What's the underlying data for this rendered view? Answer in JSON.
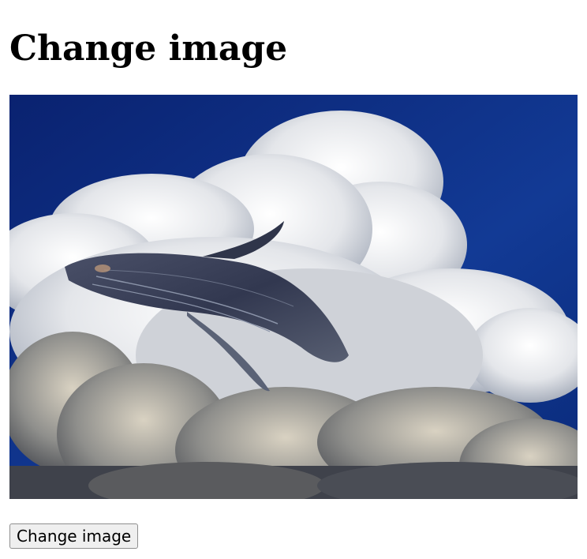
{
  "page": {
    "heading": "Change image"
  },
  "image": {
    "alt": "Humpback whale leaping through clouds",
    "sky_color": "#0b2a7a",
    "cloud_color": "#e8e6e0",
    "whale_color": "#3b4258"
  },
  "controls": {
    "change_button_label": "Change image"
  }
}
